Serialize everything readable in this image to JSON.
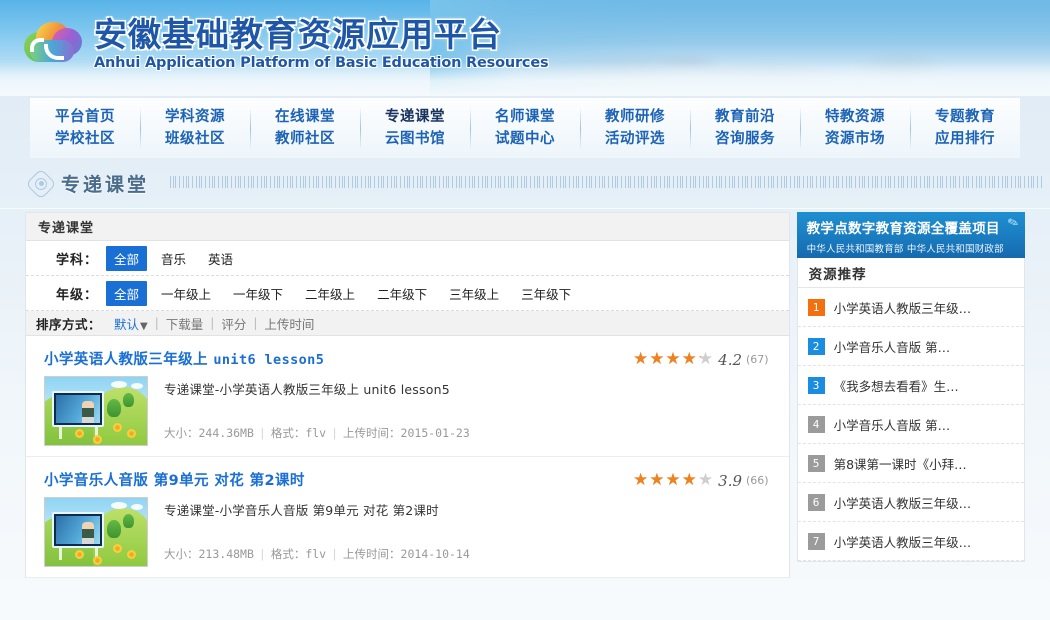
{
  "header": {
    "title_cn": "安徽基础教育资源应用平台",
    "title_en": "Anhui Application Platform of Basic Education Resources",
    "logo_icon": "rainbow-cloud-logo"
  },
  "nav": {
    "columns": [
      {
        "top": "平台首页",
        "bottom": "学校社区",
        "top_active": false,
        "bottom_active": false
      },
      {
        "top": "学科资源",
        "bottom": "班级社区",
        "top_active": false,
        "bottom_active": false
      },
      {
        "top": "在线课堂",
        "bottom": "教师社区",
        "top_active": false,
        "bottom_active": false
      },
      {
        "top": "专递课堂",
        "bottom": "云图书馆",
        "top_active": true,
        "bottom_active": false
      },
      {
        "top": "名师课堂",
        "bottom": "试题中心",
        "top_active": false,
        "bottom_active": false
      },
      {
        "top": "教师研修",
        "bottom": "活动评选",
        "top_active": false,
        "bottom_active": false
      },
      {
        "top": "教育前沿",
        "bottom": "咨询服务",
        "top_active": false,
        "bottom_active": false
      },
      {
        "top": "特教资源",
        "bottom": "资源市场",
        "top_active": false,
        "bottom_active": false
      },
      {
        "top": "专题教育",
        "bottom": "应用排行",
        "top_active": false,
        "bottom_active": false
      }
    ]
  },
  "breadcrumb": {
    "title": "专递课堂",
    "icon": "flower-ornament-icon"
  },
  "panel": {
    "title": "专递课堂",
    "filters": [
      {
        "label": "学科：",
        "options": [
          {
            "text": "全部",
            "selected": true
          },
          {
            "text": "音乐",
            "selected": false
          },
          {
            "text": "英语",
            "selected": false
          }
        ]
      },
      {
        "label": "年级：",
        "options": [
          {
            "text": "全部",
            "selected": true
          },
          {
            "text": "一年级上",
            "selected": false
          },
          {
            "text": "一年级下",
            "selected": false
          },
          {
            "text": "二年级上",
            "selected": false
          },
          {
            "text": "二年级下",
            "selected": false
          },
          {
            "text": "三年级上",
            "selected": false
          },
          {
            "text": "三年级下",
            "selected": false
          }
        ]
      }
    ],
    "sort": {
      "label": "排序方式：",
      "options": [
        {
          "text": "默认",
          "selected": true,
          "arrow": "▼"
        },
        {
          "text": "下载量",
          "selected": false
        },
        {
          "text": "评分",
          "selected": false
        },
        {
          "text": "上传时间",
          "selected": false
        }
      ],
      "separator": "|"
    }
  },
  "results": [
    {
      "title_cn": "小学英语人教版三年级上",
      "title_en": "unit6 lesson5",
      "desc": "专递课堂-小学英语人教版三年级上  unit6 lesson5",
      "size_label": "大小：",
      "size": "244.36MB",
      "format_label": "格式：",
      "format": "flv",
      "date_label": "上传时间：",
      "date": "2015-01-23",
      "rating": 4.2,
      "rating_count": "(67)",
      "thumb": "classroom-cartoon-thumbnail"
    },
    {
      "title_cn": "小学音乐人音版 第9单元 对花 第2课时",
      "title_en": "",
      "desc": "专递课堂-小学音乐人音版  第9单元  对花  第2课时",
      "size_label": "大小：",
      "size": "213.48MB",
      "format_label": "格式：",
      "format": "flv",
      "date_label": "上传时间：",
      "date": "2014-10-14",
      "rating": 3.9,
      "rating_count": "(66)",
      "thumb": "classroom-cartoon-thumbnail"
    }
  ],
  "sidebar": {
    "promo": {
      "line1": "教学点数字教育资源全覆盖项目",
      "line2": "中华人民共和国教育部   中华人民共和国财政部",
      "icon": "rocket-swoosh-icon"
    },
    "rec_title": "资源推荐",
    "rec_items": [
      {
        "rank": "1",
        "text": "小学英语人教版三年级…"
      },
      {
        "rank": "2",
        "text": "小学音乐人音版 第…"
      },
      {
        "rank": "3",
        "text": "《我多想去看看》生…"
      },
      {
        "rank": "4",
        "text": "小学音乐人音版 第…"
      },
      {
        "rank": "5",
        "text": "第8课第一课时《小拜…"
      },
      {
        "rank": "6",
        "text": "小学英语人教版三年级…"
      },
      {
        "rank": "7",
        "text": "小学英语人教版三年级…"
      }
    ]
  },
  "colors": {
    "accent_blue": "#1a6fd4",
    "nav_blue": "#1d63b5",
    "nav_active": "#17335e",
    "star_orange": "#f0821e",
    "rank1": "#f2700f",
    "rank_blue": "#1a8de0",
    "rank_gray": "#9b9b9b",
    "promo_blue": "#1a7cc0"
  }
}
